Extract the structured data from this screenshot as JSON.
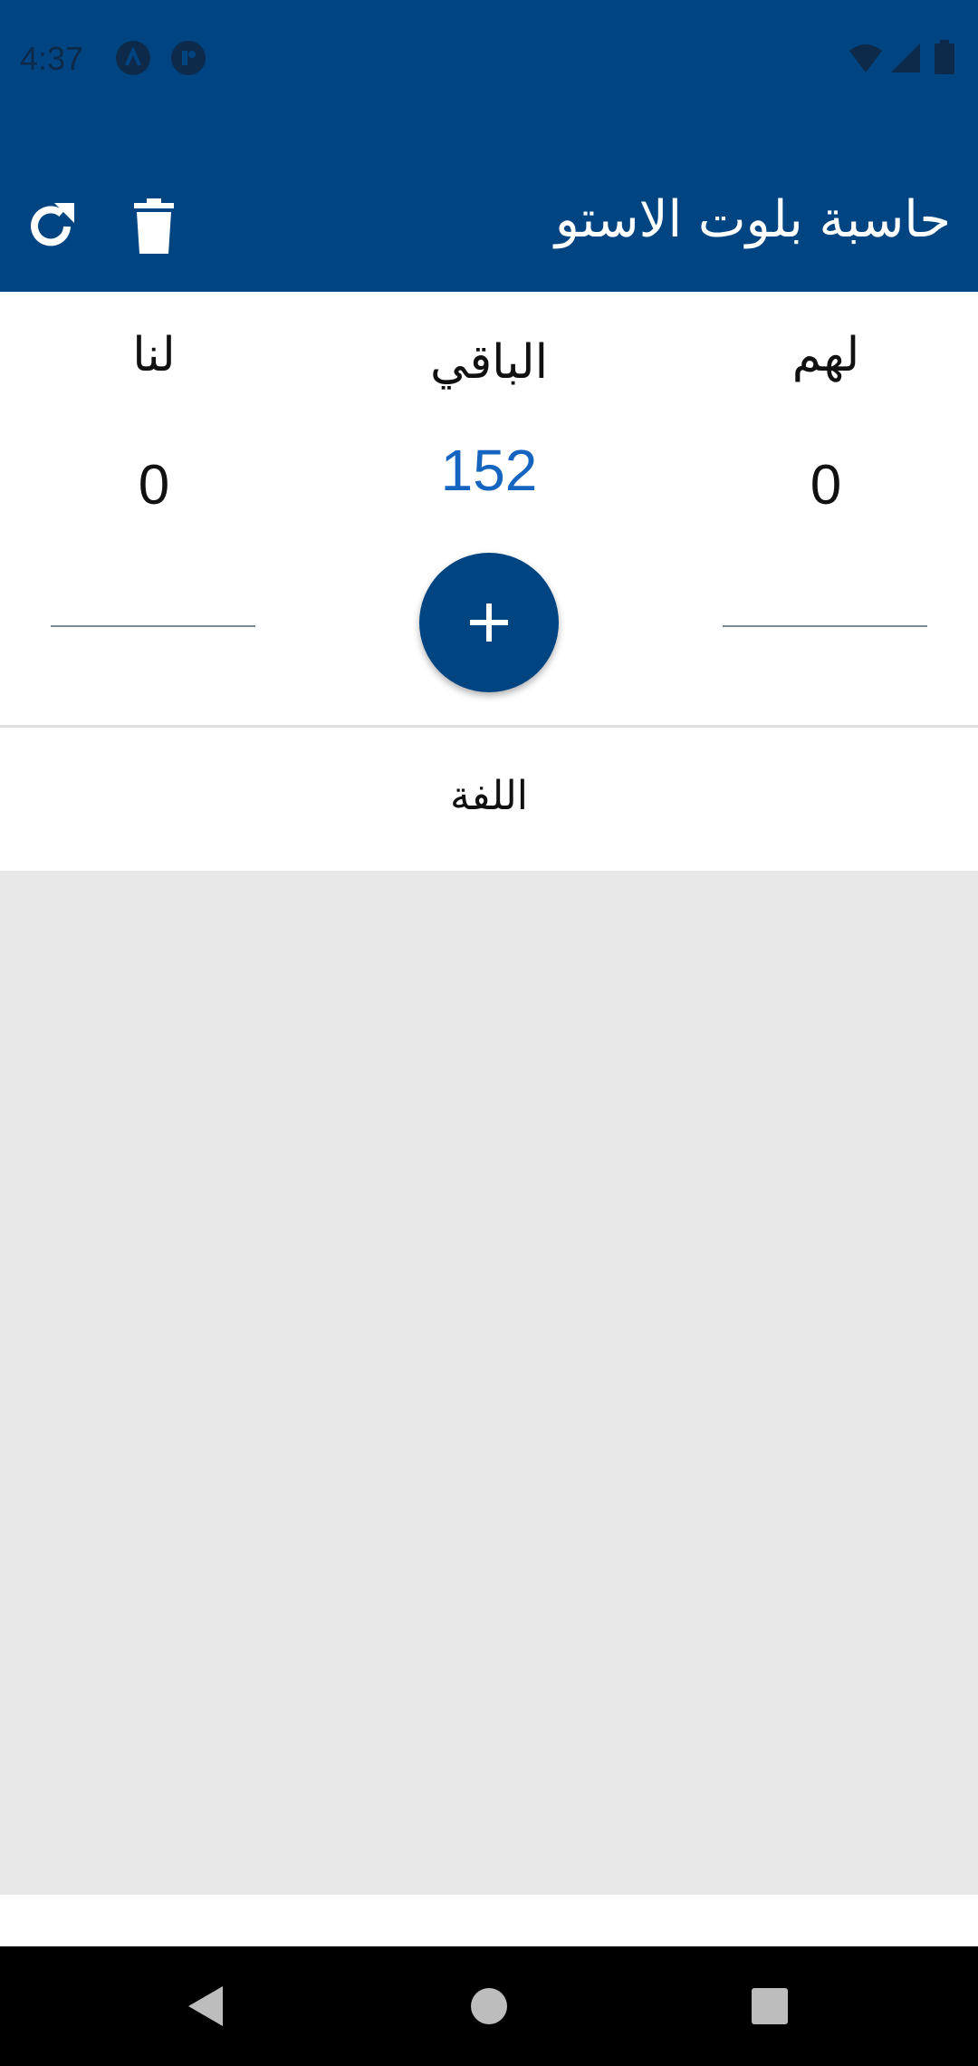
{
  "status_bar": {
    "time": "4:37",
    "icons": [
      "app-notification-icon",
      "app-notification-icon-2",
      "wifi-icon",
      "signal-icon",
      "battery-icon"
    ]
  },
  "app_bar": {
    "title": "حاسبة بلوت الاستو",
    "actions": [
      "refresh-icon",
      "delete-icon"
    ]
  },
  "scores": {
    "them_label": "لهم",
    "them_value": "0",
    "remaining_label": "الباقي",
    "remaining_value": "152",
    "us_label": "لنا",
    "us_value": "0",
    "them_input_placeholder": "",
    "us_input_placeholder": "",
    "add_label": "+"
  },
  "rounds": {
    "header": "اللفة"
  },
  "nav_bar": {
    "buttons": [
      "back-icon",
      "home-icon",
      "recents-icon"
    ]
  },
  "colors": {
    "primary": "#004481",
    "accent_text": "#1565c0",
    "list_bg": "#e8e8e8"
  }
}
